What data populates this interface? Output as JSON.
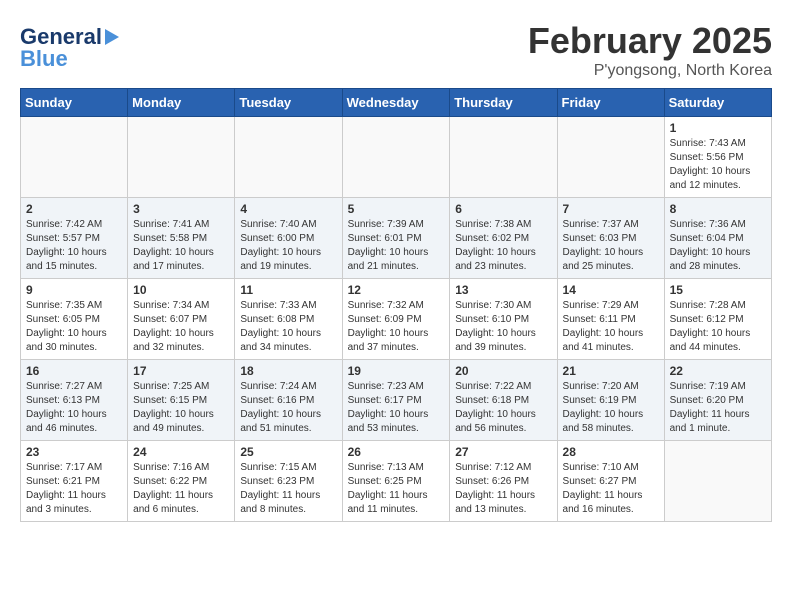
{
  "header": {
    "title": "February 2025",
    "subtitle": "P'yongsong, North Korea",
    "logo_general": "General",
    "logo_blue": "Blue"
  },
  "weekdays": [
    "Sunday",
    "Monday",
    "Tuesday",
    "Wednesday",
    "Thursday",
    "Friday",
    "Saturday"
  ],
  "weeks": [
    [
      {
        "day": "",
        "info": ""
      },
      {
        "day": "",
        "info": ""
      },
      {
        "day": "",
        "info": ""
      },
      {
        "day": "",
        "info": ""
      },
      {
        "day": "",
        "info": ""
      },
      {
        "day": "",
        "info": ""
      },
      {
        "day": "1",
        "info": "Sunrise: 7:43 AM\nSunset: 5:56 PM\nDaylight: 10 hours\nand 12 minutes."
      }
    ],
    [
      {
        "day": "2",
        "info": "Sunrise: 7:42 AM\nSunset: 5:57 PM\nDaylight: 10 hours\nand 15 minutes."
      },
      {
        "day": "3",
        "info": "Sunrise: 7:41 AM\nSunset: 5:58 PM\nDaylight: 10 hours\nand 17 minutes."
      },
      {
        "day": "4",
        "info": "Sunrise: 7:40 AM\nSunset: 6:00 PM\nDaylight: 10 hours\nand 19 minutes."
      },
      {
        "day": "5",
        "info": "Sunrise: 7:39 AM\nSunset: 6:01 PM\nDaylight: 10 hours\nand 21 minutes."
      },
      {
        "day": "6",
        "info": "Sunrise: 7:38 AM\nSunset: 6:02 PM\nDaylight: 10 hours\nand 23 minutes."
      },
      {
        "day": "7",
        "info": "Sunrise: 7:37 AM\nSunset: 6:03 PM\nDaylight: 10 hours\nand 25 minutes."
      },
      {
        "day": "8",
        "info": "Sunrise: 7:36 AM\nSunset: 6:04 PM\nDaylight: 10 hours\nand 28 minutes."
      }
    ],
    [
      {
        "day": "9",
        "info": "Sunrise: 7:35 AM\nSunset: 6:05 PM\nDaylight: 10 hours\nand 30 minutes."
      },
      {
        "day": "10",
        "info": "Sunrise: 7:34 AM\nSunset: 6:07 PM\nDaylight: 10 hours\nand 32 minutes."
      },
      {
        "day": "11",
        "info": "Sunrise: 7:33 AM\nSunset: 6:08 PM\nDaylight: 10 hours\nand 34 minutes."
      },
      {
        "day": "12",
        "info": "Sunrise: 7:32 AM\nSunset: 6:09 PM\nDaylight: 10 hours\nand 37 minutes."
      },
      {
        "day": "13",
        "info": "Sunrise: 7:30 AM\nSunset: 6:10 PM\nDaylight: 10 hours\nand 39 minutes."
      },
      {
        "day": "14",
        "info": "Sunrise: 7:29 AM\nSunset: 6:11 PM\nDaylight: 10 hours\nand 41 minutes."
      },
      {
        "day": "15",
        "info": "Sunrise: 7:28 AM\nSunset: 6:12 PM\nDaylight: 10 hours\nand 44 minutes."
      }
    ],
    [
      {
        "day": "16",
        "info": "Sunrise: 7:27 AM\nSunset: 6:13 PM\nDaylight: 10 hours\nand 46 minutes."
      },
      {
        "day": "17",
        "info": "Sunrise: 7:25 AM\nSunset: 6:15 PM\nDaylight: 10 hours\nand 49 minutes."
      },
      {
        "day": "18",
        "info": "Sunrise: 7:24 AM\nSunset: 6:16 PM\nDaylight: 10 hours\nand 51 minutes."
      },
      {
        "day": "19",
        "info": "Sunrise: 7:23 AM\nSunset: 6:17 PM\nDaylight: 10 hours\nand 53 minutes."
      },
      {
        "day": "20",
        "info": "Sunrise: 7:22 AM\nSunset: 6:18 PM\nDaylight: 10 hours\nand 56 minutes."
      },
      {
        "day": "21",
        "info": "Sunrise: 7:20 AM\nSunset: 6:19 PM\nDaylight: 10 hours\nand 58 minutes."
      },
      {
        "day": "22",
        "info": "Sunrise: 7:19 AM\nSunset: 6:20 PM\nDaylight: 11 hours\nand 1 minute."
      }
    ],
    [
      {
        "day": "23",
        "info": "Sunrise: 7:17 AM\nSunset: 6:21 PM\nDaylight: 11 hours\nand 3 minutes."
      },
      {
        "day": "24",
        "info": "Sunrise: 7:16 AM\nSunset: 6:22 PM\nDaylight: 11 hours\nand 6 minutes."
      },
      {
        "day": "25",
        "info": "Sunrise: 7:15 AM\nSunset: 6:23 PM\nDaylight: 11 hours\nand 8 minutes."
      },
      {
        "day": "26",
        "info": "Sunrise: 7:13 AM\nSunset: 6:25 PM\nDaylight: 11 hours\nand 11 minutes."
      },
      {
        "day": "27",
        "info": "Sunrise: 7:12 AM\nSunset: 6:26 PM\nDaylight: 11 hours\nand 13 minutes."
      },
      {
        "day": "28",
        "info": "Sunrise: 7:10 AM\nSunset: 6:27 PM\nDaylight: 11 hours\nand 16 minutes."
      },
      {
        "day": "",
        "info": ""
      }
    ]
  ]
}
